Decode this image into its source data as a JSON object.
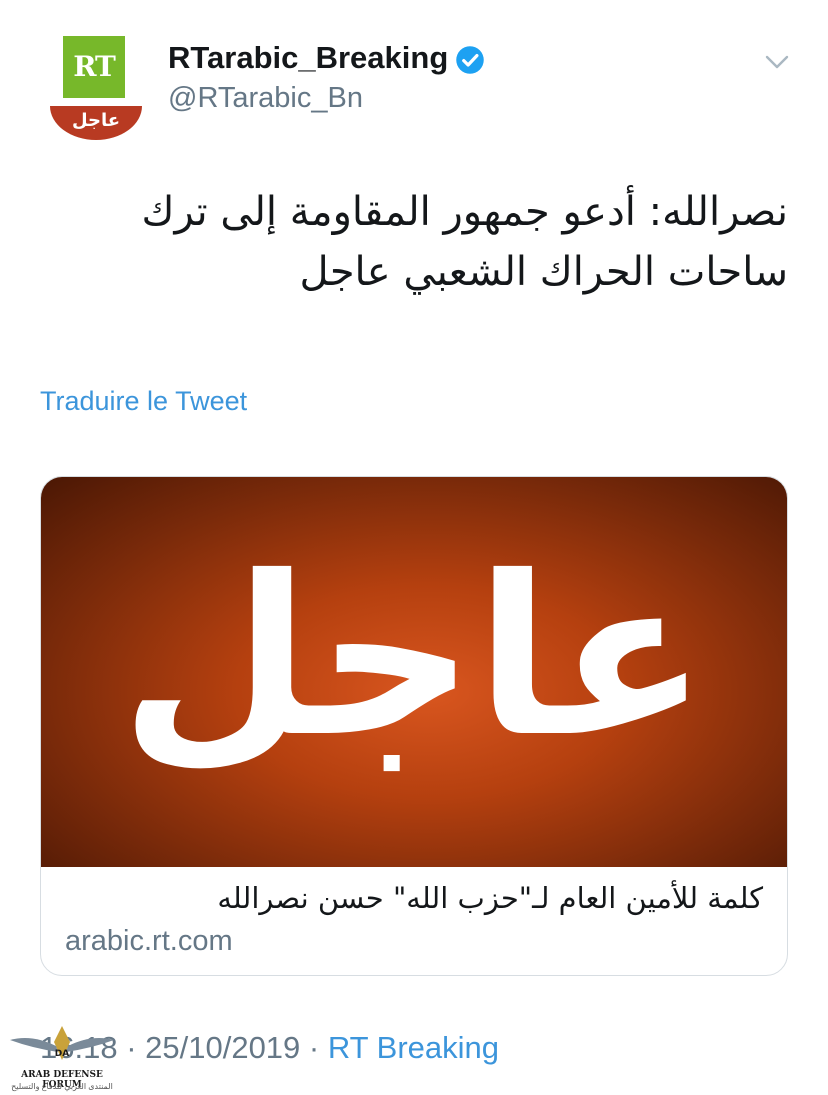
{
  "header": {
    "avatar_logo_text": "RT",
    "avatar_banner_text": "عاجل",
    "display_name": "RTarabic_Breaking",
    "handle": "@RTarabic_Bn"
  },
  "tweet": {
    "text": "نصرالله: أدعو جمهور المقاومة إلى ترك ساحات الحراك الشعبي عاجل",
    "translate_label": "Traduire le Tweet"
  },
  "card": {
    "image_text": "عاجل",
    "title": "كلمة للأمين العام لـ\"حزب الله\" حسن نصرالله",
    "domain": "arabic.rt.com"
  },
  "meta": {
    "time": "16:18",
    "separator": " · ",
    "date": "25/10/2019",
    "source": "RT Breaking"
  },
  "watermark": {
    "title": "ARAB DEFENSE FORUM",
    "subtitle": "المنتدى العربي للدفاع والتسليح"
  },
  "colors": {
    "link": "#3c95db",
    "verified": "#1da1f2",
    "rt_green": "#77b82a",
    "rt_red": "#b83a22",
    "secondary_text": "#657786"
  }
}
